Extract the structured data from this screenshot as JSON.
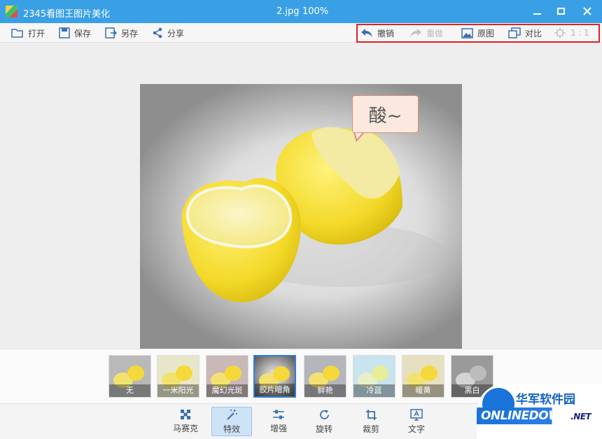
{
  "window": {
    "app_title": "2345看图王图片美化",
    "file_name": "2.jpg",
    "zoom": "100%"
  },
  "toolbar": {
    "open": "打开",
    "save": "保存",
    "save_as": "另存",
    "share": "分享",
    "undo": "撤销",
    "redo": "重做",
    "original": "原图",
    "compare": "对比",
    "ratio": "1 : 1"
  },
  "photo": {
    "bubble_text": "酸~"
  },
  "filters": [
    {
      "label": "无",
      "tint": "#b9b9b9"
    },
    {
      "label": "一米阳光",
      "tint": "#e8e6c9"
    },
    {
      "label": "魔幻光斑",
      "tint": "#c9b8b8"
    },
    {
      "label": "胶片暗角",
      "tint": "#6e6e6e"
    },
    {
      "label": "鲜艳",
      "tint": "#b5b5bd"
    },
    {
      "label": "冷蓝",
      "tint": "#c8e4ee"
    },
    {
      "label": "暖黄",
      "tint": "#e6e0c0"
    },
    {
      "label": "黑白",
      "tint": "#9a9a9a"
    }
  ],
  "tools": {
    "mosaic": "马赛克",
    "effects": "特效",
    "enhance": "增强",
    "rotate": "旋转",
    "crop": "裁剪",
    "text": "文字"
  },
  "watermark": {
    "cn": "华军软件园",
    "en_a": "O",
    "en_b": "NLINEDOWN",
    "en_c": ".NET"
  },
  "colors": {
    "titlebar": "#3aa0e6",
    "accent": "#2f7fd8",
    "highlight_box": "#e02020"
  }
}
